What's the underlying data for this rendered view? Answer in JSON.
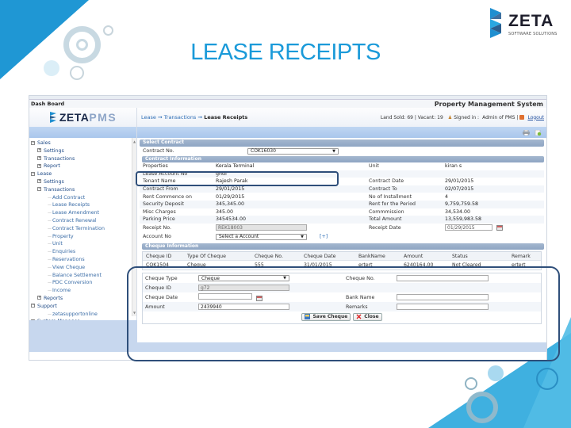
{
  "slide": {
    "title": "LEASE RECEIPTS",
    "logo": {
      "word": "ZETA",
      "tagline": "SOFTWARE SOLUTIONS"
    }
  },
  "app": {
    "top_label": "Dash Board",
    "system_title": "Property Management System",
    "brand": {
      "primary": "ZETA",
      "secondary": "PMS"
    },
    "breadcrumb": [
      "Lease",
      "Transactions",
      "Lease Receipts"
    ],
    "status": {
      "stats": "Land Sold: 69 | Vacant: 19",
      "signed_in_label": "Signed in :",
      "user": "Admin of PMS",
      "separator": "|",
      "logout": "Logout"
    },
    "toolbar_icons": [
      "print-icon",
      "export-icon"
    ]
  },
  "sidebar": {
    "items": [
      {
        "label": "Sales",
        "level": 0,
        "toggle": "−"
      },
      {
        "label": "Settings",
        "level": 1,
        "toggle": "+"
      },
      {
        "label": "Transactions",
        "level": 1,
        "toggle": "+"
      },
      {
        "label": "Report",
        "level": 1,
        "toggle": "+"
      },
      {
        "label": "Lease",
        "level": 0,
        "toggle": "−"
      },
      {
        "label": "Settings",
        "level": 1,
        "toggle": "+"
      },
      {
        "label": "Transactions",
        "level": 1,
        "toggle": "−"
      },
      {
        "label": "Add Contract",
        "level": 2
      },
      {
        "label": "Lease Receipts",
        "level": 2
      },
      {
        "label": "Lease Amendment",
        "level": 2
      },
      {
        "label": "Contract Renewal",
        "level": 2
      },
      {
        "label": "Contract Termination",
        "level": 2
      },
      {
        "label": "Property",
        "level": 2
      },
      {
        "label": "Unit",
        "level": 2
      },
      {
        "label": "Enquiries",
        "level": 2
      },
      {
        "label": "Reservations",
        "level": 2
      },
      {
        "label": "View Cheque",
        "level": 2
      },
      {
        "label": "Balance Settlement",
        "level": 2
      },
      {
        "label": "PDC Conversion",
        "level": 2
      },
      {
        "label": "Income",
        "level": 2
      },
      {
        "label": "Reports",
        "level": 1,
        "toggle": "+"
      },
      {
        "label": "Support",
        "level": 0,
        "toggle": "−"
      },
      {
        "label": "zetasupportonline",
        "level": 2
      },
      {
        "label": "System Manager",
        "level": 0,
        "toggle": "+"
      }
    ]
  },
  "select_contract": {
    "header": "Select Contract",
    "contract_no_label": "Contract No.",
    "contract_no_value": "COK16030"
  },
  "contract_info": {
    "header": "Contract Information",
    "left": [
      {
        "label": "Properties",
        "value": "Kerala Terminal"
      },
      {
        "label": "Lease Account No",
        "value": "ghdf"
      },
      {
        "label": "Tenant Name",
        "value": "Rajesh Parak"
      },
      {
        "label": "Contract From",
        "value": "29/01/2015"
      },
      {
        "label": "Rent Commence on",
        "value": "01/29/2015"
      },
      {
        "label": "Security Deposit",
        "value": "345,345.00"
      },
      {
        "label": "Misc Charges",
        "value": "345.00"
      },
      {
        "label": "Parking Price",
        "value": "3454534.00"
      }
    ],
    "right": [
      {
        "label": "Unit",
        "value": "kiran s"
      },
      {
        "label": "",
        "value": ""
      },
      {
        "label": "Contract Date",
        "value": "29/01/2015"
      },
      {
        "label": "Contract To",
        "value": "02/07/2015"
      },
      {
        "label": "No of Installment",
        "value": "4"
      },
      {
        "label": "Rent for the Period",
        "value": "9,759,759.58"
      },
      {
        "label": "Commmission",
        "value": "34,534.00"
      },
      {
        "label": "Total Amount",
        "value": "13,559,983.58"
      }
    ],
    "receipt_no_label": "Receipt No.",
    "receipt_no_value": "REK18003",
    "receipt_date_label": "Receipt Date",
    "receipt_date_value": "01/29/2015",
    "account_no_label": "Account No",
    "account_no_value": "Select a Account",
    "account_add_link": "[+]"
  },
  "cheque_info": {
    "header": "Cheque Information",
    "columns": [
      "Cheque ID",
      "Type Of Cheque",
      "Cheque No.",
      "Cheque Date",
      "BankName",
      "Amount",
      "Status",
      "Remark"
    ],
    "rows": [
      [
        "CQK1504",
        "Cheque",
        "555",
        "31/01/2015",
        "ertert",
        "6240164.00",
        "Not Cleared",
        "ertert"
      ]
    ]
  },
  "cheque_form": {
    "cheque_type_label": "Cheque Type",
    "cheque_type_value": "Cheque",
    "cheque_no_label": "Cheque No.",
    "cheque_no_value": "",
    "cheque_id_label": "Cheque ID",
    "cheque_id_value": "g72",
    "cheque_date_label": "Cheque Date",
    "cheque_date_value": "",
    "bank_name_label": "Bank Name",
    "bank_name_value": "",
    "amount_label": "Amount",
    "amount_value": "2439940",
    "remarks_label": "Remarks",
    "remarks_value": "",
    "save_button": "Save Cheque",
    "close_button": "Close"
  },
  "colors": {
    "title_blue": "#1a9ad9",
    "section_header": "#8ea5c3",
    "highlight_border": "#2f4f7a",
    "link_blue": "#2b6cb5"
  }
}
